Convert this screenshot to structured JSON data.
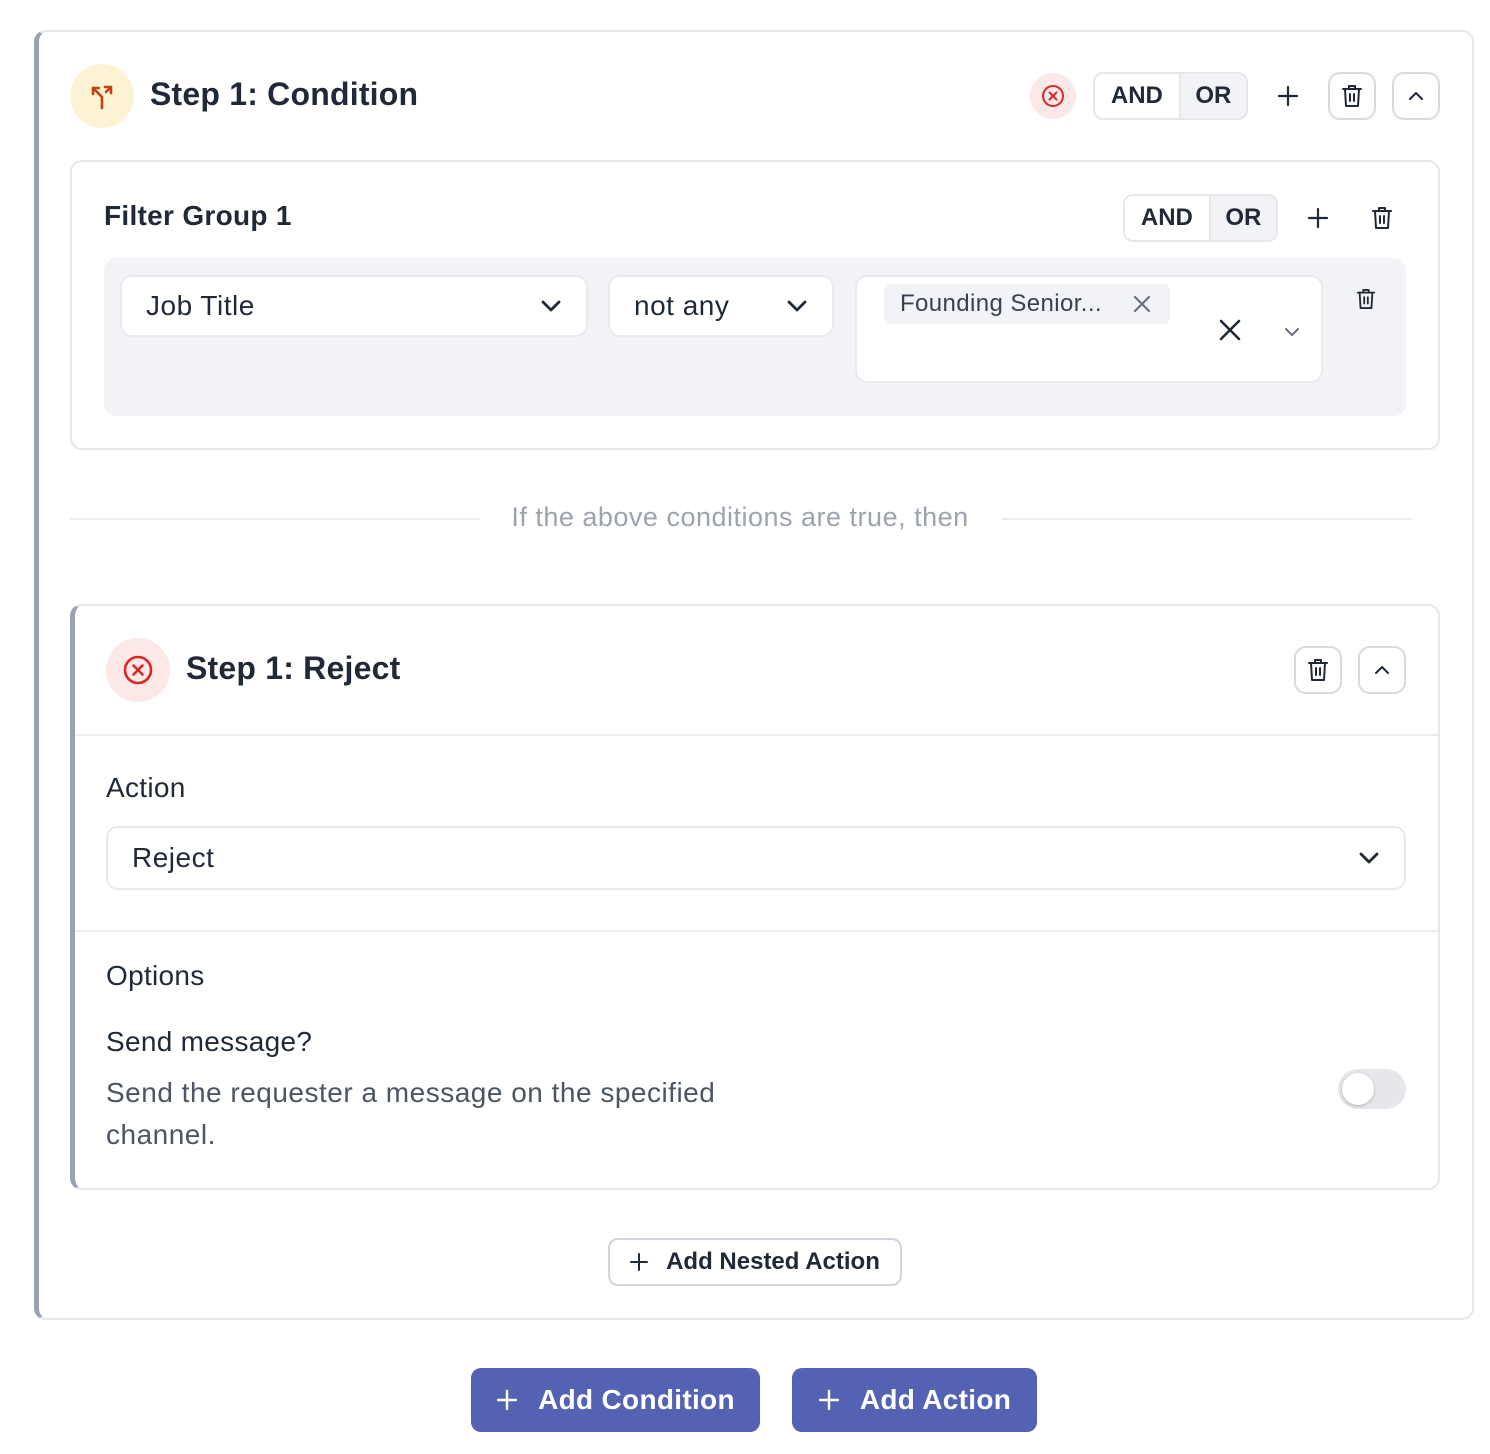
{
  "condition_step": {
    "title": "Step 1: Condition",
    "and_label": "AND",
    "or_label": "OR"
  },
  "filter_group": {
    "title": "Filter Group 1",
    "and_label": "AND",
    "or_label": "OR",
    "field_value": "Job Title",
    "operator_value": "not any",
    "tags": [
      "Founding Senior..."
    ]
  },
  "divider": {
    "text": "If the above conditions are true, then"
  },
  "reject_step": {
    "title": "Step 1: Reject",
    "action_label": "Action",
    "action_value": "Reject",
    "options_label": "Options",
    "send_message_label": "Send message?",
    "send_message_description": "Send the requester a message on the specified channel.",
    "send_message_enabled": false
  },
  "buttons": {
    "add_nested_action": "Add Nested Action",
    "add_condition": "Add Condition",
    "add_action": "Add Action"
  },
  "colors": {
    "primary": "#5462b3",
    "danger": "#dc2626",
    "warning_bg": "#fef3c7",
    "warning_icon": "#c2410c"
  }
}
